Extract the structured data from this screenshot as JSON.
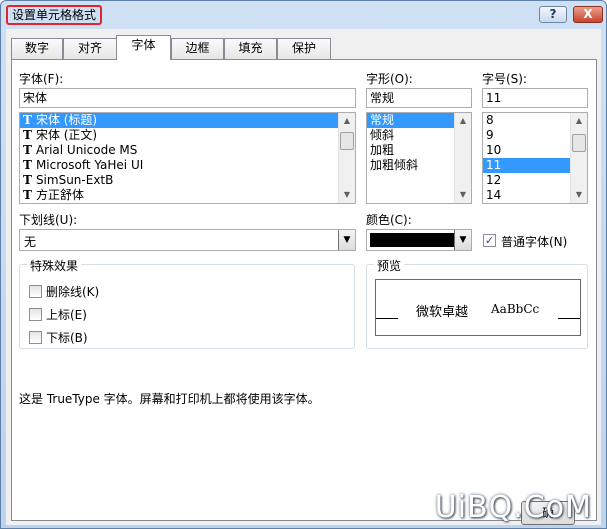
{
  "window": {
    "title": "设置单元格格式",
    "help_label": "?",
    "close_label": "X"
  },
  "tabs": [
    {
      "label": "数字"
    },
    {
      "label": "对齐"
    },
    {
      "label": "字体",
      "active": true
    },
    {
      "label": "边框"
    },
    {
      "label": "填充"
    },
    {
      "label": "保护"
    }
  ],
  "font": {
    "label": "字体(F):",
    "value": "宋体",
    "items": [
      "宋体 (标题)",
      "宋体 (正文)",
      "Arial Unicode MS",
      "Microsoft YaHei UI",
      "SimSun-ExtB",
      "方正舒体"
    ],
    "selected_index": 0,
    "icon": "truetype-icon"
  },
  "style": {
    "label": "字形(O):",
    "value": "常规",
    "items": [
      "常规",
      "倾斜",
      "加粗",
      "加粗倾斜"
    ],
    "selected_index": 0
  },
  "size": {
    "label": "字号(S):",
    "value": "11",
    "items": [
      "8",
      "9",
      "10",
      "11",
      "12",
      "14"
    ],
    "selected_index": 3
  },
  "underline": {
    "label": "下划线(U):",
    "value": "无"
  },
  "color": {
    "label": "颜色(C):",
    "value": "#000000"
  },
  "normal_font": {
    "label": "普通字体(N)",
    "checked": true
  },
  "effects": {
    "title": "特殊效果",
    "items": [
      {
        "label": "删除线(K)",
        "checked": false
      },
      {
        "label": "上标(E)",
        "checked": false
      },
      {
        "label": "下标(B)",
        "checked": false
      }
    ]
  },
  "preview": {
    "title": "预览",
    "sample_cn": "微软卓越",
    "sample_en": "AaBbCc"
  },
  "info_text": "这是 TrueType 字体。屏幕和打印机上都将使用该字体。",
  "ok_partial": "确",
  "watermark": "UiBQ.CoM",
  "colors": {
    "selection": "#3399ff",
    "title_highlight": "#e0262b",
    "close_button": "#c8432d"
  }
}
